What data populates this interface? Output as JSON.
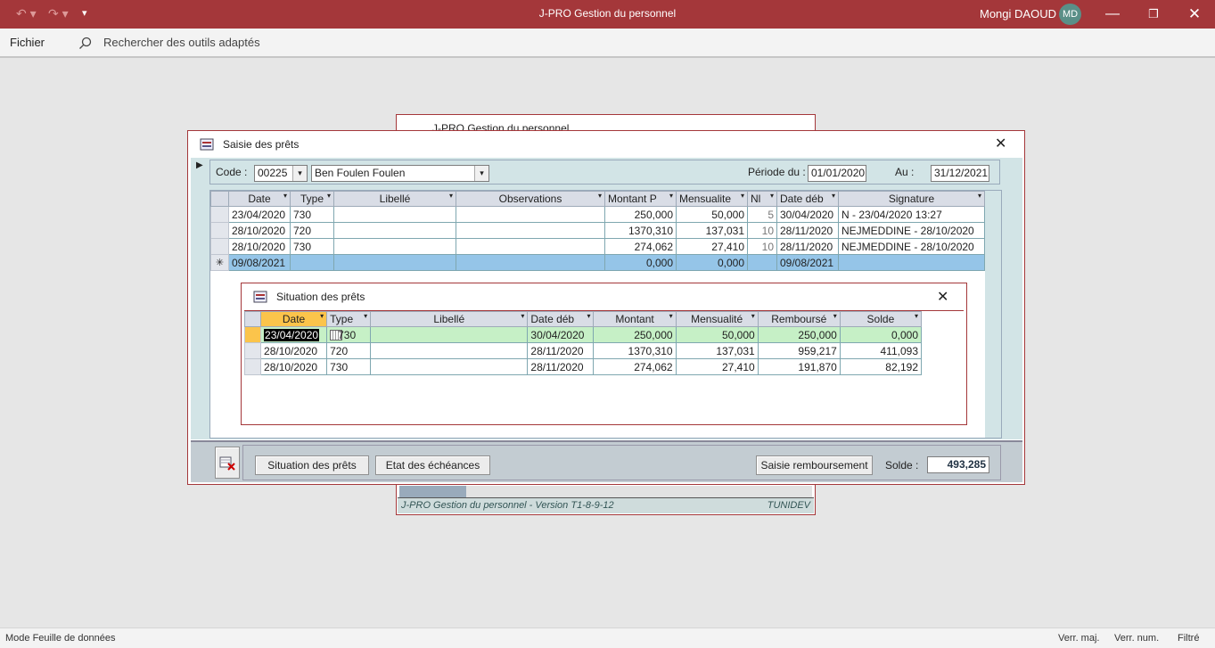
{
  "app": {
    "title": "J-PRO Gestion du personnel",
    "user_name": "Mongi DAOUD",
    "user_initials": "MD"
  },
  "menu": {
    "file": "Fichier",
    "search_placeholder": "Rechercher des outils adaptés"
  },
  "background_form": {
    "title": "J-PRO Gestion du personnel",
    "footer_version": "J-PRO Gestion du personnel - Version T1-8-9-12",
    "footer_vendor": "TUNIDEV"
  },
  "saisie": {
    "title": "Saisie des prêts",
    "code_label": "Code :",
    "code_value": "00225",
    "name_value": "Ben Foulen Foulen",
    "period_label": "Période du :",
    "period_from": "01/01/2020",
    "period_to_label": "Au :",
    "period_to": "31/12/2021",
    "columns": [
      "Date",
      "Type",
      "Libellé",
      "Observations",
      "Montant P",
      "Mensualite",
      "Nl",
      "Date déb",
      "Signature"
    ],
    "rows": [
      {
        "date": "23/04/2020",
        "type": "730",
        "libelle": "",
        "obs": "",
        "montant": "250,000",
        "mensualite": "50,000",
        "nb": "5",
        "date_deb": "30/04/2020",
        "signature": "N - 23/04/2020 13:27"
      },
      {
        "date": "28/10/2020",
        "type": "720",
        "libelle": "",
        "obs": "",
        "montant": "1370,310",
        "mensualite": "137,031",
        "nb": "10",
        "date_deb": "28/11/2020",
        "signature": "NEJMEDDINE - 28/10/2020"
      },
      {
        "date": "28/10/2020",
        "type": "730",
        "libelle": "",
        "obs": "",
        "montant": "274,062",
        "mensualite": "27,410",
        "nb": "10",
        "date_deb": "28/11/2020",
        "signature": "NEJMEDDINE - 28/10/2020"
      }
    ],
    "new_row": {
      "marker": "✳",
      "date": "09/08/2021",
      "montant": "0,000",
      "mensualite": "0,000",
      "date_deb": "09/08/2021"
    },
    "btn_situation": "Situation des prêts",
    "btn_echeances": "Etat des échéances",
    "btn_remboursement": "Saisie remboursement",
    "solde_label": "Solde :",
    "solde_value": "493,285"
  },
  "situation": {
    "title": "Situation des prêts",
    "columns": [
      "Date",
      "Type",
      "Libellé",
      "Date déb",
      "Montant",
      "Mensualité",
      "Remboursé",
      "Solde"
    ],
    "rows": [
      {
        "date": "23/04/2020",
        "type": "730",
        "libelle": "",
        "date_deb": "30/04/2020",
        "montant": "250,000",
        "mensualite": "50,000",
        "rembourse": "250,000",
        "solde": "0,000"
      },
      {
        "date": "28/10/2020",
        "type": "720",
        "libelle": "",
        "date_deb": "28/11/2020",
        "montant": "1370,310",
        "mensualite": "137,031",
        "rembourse": "959,217",
        "solde": "411,093"
      },
      {
        "date": "28/10/2020",
        "type": "730",
        "libelle": "",
        "date_deb": "28/11/2020",
        "montant": "274,062",
        "mensualite": "27,410",
        "rembourse": "191,870",
        "solde": "82,192"
      }
    ]
  },
  "status": {
    "mode": "Mode Feuille de données",
    "caps": "Verr. maj.",
    "num": "Verr. num.",
    "filter": "Filtré"
  },
  "colors": {
    "accent": "#a4373a",
    "form_bg": "#d2e4e6",
    "new_row": "#95c5e8",
    "active_row": "#c6f0c6",
    "active_header": "#fbc44b"
  }
}
